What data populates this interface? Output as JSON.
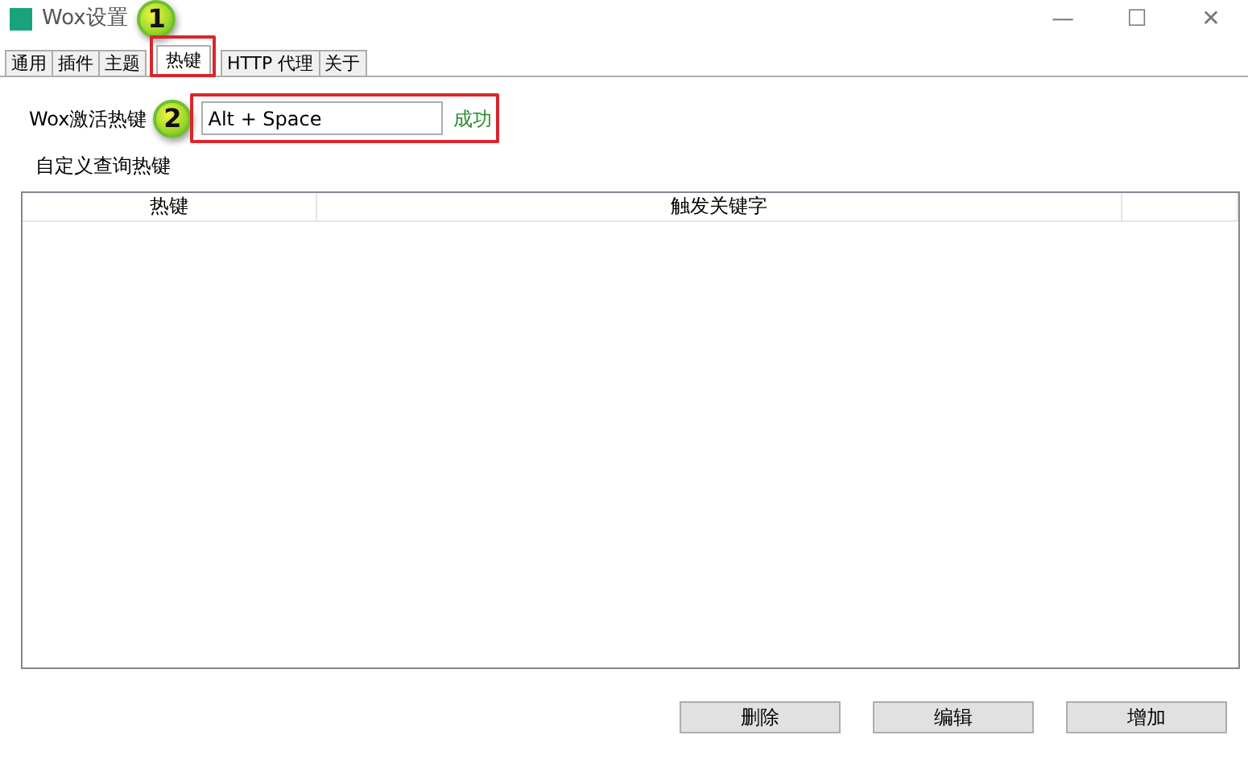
{
  "window": {
    "title": "Wox设置",
    "controls": [
      "—",
      "☐",
      "✕"
    ]
  },
  "tabs": [
    {
      "label": "通用",
      "selected": false
    },
    {
      "label": "插件",
      "selected": false
    },
    {
      "label": "主题",
      "selected": false
    },
    {
      "label": "热键",
      "selected": true
    },
    {
      "label": "HTTP 代理",
      "selected": false
    },
    {
      "label": "关于",
      "selected": false
    }
  ],
  "hotkey": {
    "label": "Wox激活热键",
    "value": "Alt + Space",
    "status": "成功"
  },
  "custom": {
    "title": "自定义查询热键",
    "columns": [
      "热键",
      "触发关键字"
    ]
  },
  "buttons": [
    "删除",
    "编辑",
    "增加"
  ],
  "callouts": [
    "1",
    "2"
  ]
}
